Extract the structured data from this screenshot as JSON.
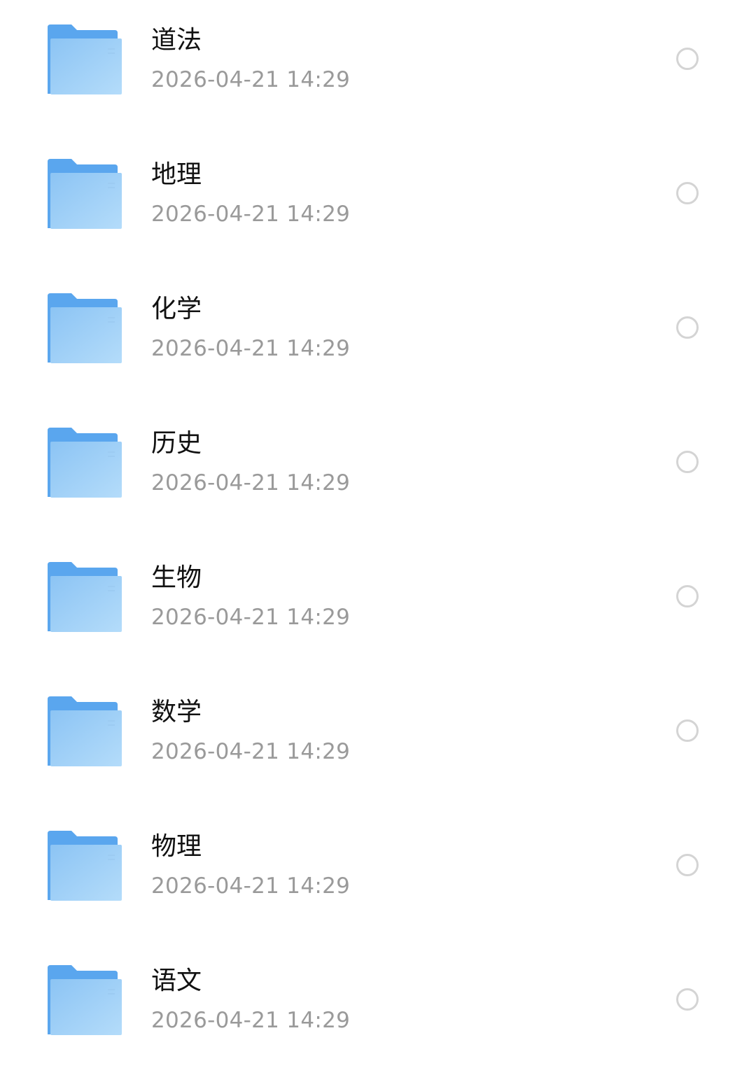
{
  "folders": [
    {
      "name": "道法",
      "modified": "2026-04-21 14:29",
      "selected": false
    },
    {
      "name": "地理",
      "modified": "2026-04-21 14:29",
      "selected": false
    },
    {
      "name": "化学",
      "modified": "2026-04-21 14:29",
      "selected": false
    },
    {
      "name": "历史",
      "modified": "2026-04-21 14:29",
      "selected": false
    },
    {
      "name": "生物",
      "modified": "2026-04-21 14:29",
      "selected": false
    },
    {
      "name": "数学",
      "modified": "2026-04-21 14:29",
      "selected": false
    },
    {
      "name": "物理",
      "modified": "2026-04-21 14:29",
      "selected": false
    },
    {
      "name": "语文",
      "modified": "2026-04-21 14:29",
      "selected": false
    }
  ],
  "colors": {
    "folder_back": "#5aa6ee",
    "folder_front_light": "#b4dcfa",
    "folder_front_dark": "#8cc4f4",
    "name_text": "#111111",
    "date_text": "#9a9a9a",
    "radio_border": "#d4d4d4"
  },
  "icons": {
    "folder": "folder-icon",
    "select": "radio-unchecked-icon"
  }
}
